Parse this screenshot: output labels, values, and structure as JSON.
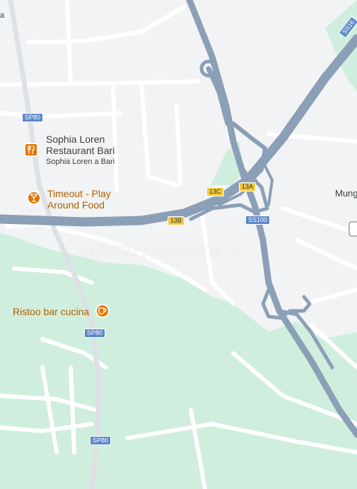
{
  "map": {
    "colors": {
      "background": "#f1f3f4",
      "park": "#cfeedd",
      "minor_road": "#ffffff",
      "major_road": "#8b9fb6",
      "blue_shield": "#5b87c7",
      "yellow_shield": "#f3c83a",
      "poi_orange": "#e37400",
      "poi_text": "#b06000"
    },
    "pois": [
      {
        "name_line1": "Sophia Loren",
        "name_line2": "Restaurant Bari",
        "subtitle": "Sophia Loren a Bari",
        "icon": "restaurant-icon"
      },
      {
        "name_line1": "Timeout - Play",
        "name_line2": "Around Food",
        "icon": "cocktail-bar-icon"
      },
      {
        "name_line1": "Ristoo bar cucina",
        "icon": "coffee-cup-icon"
      }
    ],
    "road_shields": {
      "sp80_top": "SP80",
      "sp80_middle": "SP80",
      "sp80_bottom": "SP80",
      "ss100": "SS100",
      "ss16": "SS16",
      "exit_13a": "13A",
      "exit_13b": "13B",
      "exit_13c": "13C"
    },
    "place_labels": {
      "mung": "Mung",
      "corner_a": "a"
    },
    "watermark": "immobiliare.it"
  }
}
